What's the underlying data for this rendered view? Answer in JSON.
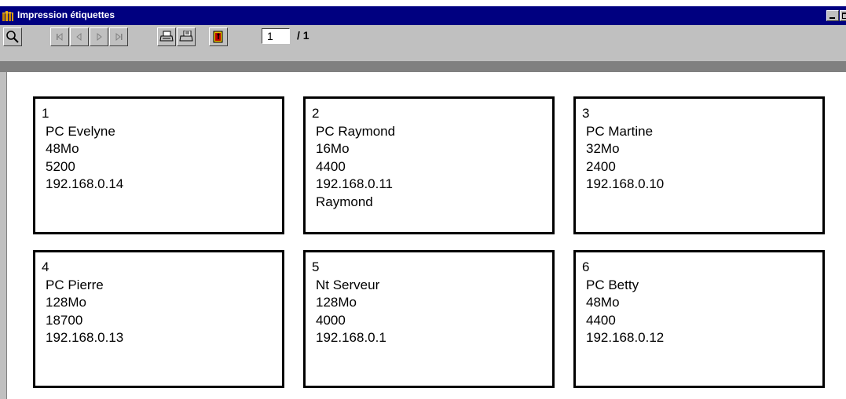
{
  "window": {
    "title": "Impression étiquettes"
  },
  "toolbar": {
    "buttons": [
      {
        "icon": "zoom-icon"
      },
      {
        "icon": "first-page-icon"
      },
      {
        "icon": "previous-page-icon"
      },
      {
        "icon": "next-page-icon"
      },
      {
        "icon": "last-page-icon"
      },
      {
        "icon": "print-icon"
      },
      {
        "icon": "print-setup-icon"
      },
      {
        "icon": "exit-icon"
      }
    ],
    "current_page": "1",
    "total_pages": "/ 1"
  },
  "labels": [
    {
      "number": "1",
      "name": "PC Evelyne",
      "memory": "48Mo",
      "value": "5200",
      "ip": "192.168.0.14",
      "extra": ""
    },
    {
      "number": "2",
      "name": "PC Raymond",
      "memory": "16Mo",
      "value": "4400",
      "ip": "192.168.0.11",
      "extra": "Raymond"
    },
    {
      "number": "3",
      "name": "PC Martine",
      "memory": "32Mo",
      "value": "2400",
      "ip": "192.168.0.10",
      "extra": ""
    },
    {
      "number": "4",
      "name": "PC Pierre",
      "memory": "128Mo",
      "value": "18700",
      "ip": "192.168.0.13",
      "extra": ""
    },
    {
      "number": "5",
      "name": "Nt Serveur",
      "memory": "128Mo",
      "value": "4000",
      "ip": "192.168.0.1",
      "extra": ""
    },
    {
      "number": "6",
      "name": "PC Betty",
      "memory": "48Mo",
      "value": "4400",
      "ip": "192.168.0.12",
      "extra": ""
    }
  ]
}
